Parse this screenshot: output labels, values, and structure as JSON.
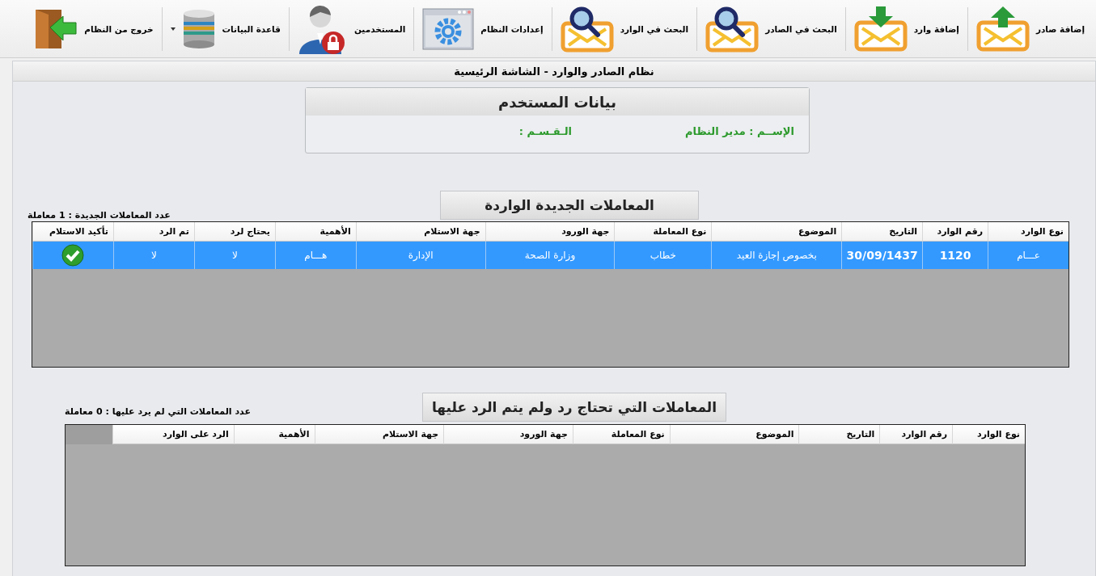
{
  "toolbar": [
    {
      "label": "إضافة صادر",
      "kind": "upload",
      "dropdown": false
    },
    {
      "label": "إضافة وارد",
      "kind": "download",
      "dropdown": false
    },
    {
      "label": "البحث في الصادر",
      "kind": "search",
      "dropdown": false
    },
    {
      "label": "البحث في الوارد",
      "kind": "search",
      "dropdown": false
    },
    {
      "label": "إعدادات النظام",
      "kind": "settings",
      "dropdown": false
    },
    {
      "label": "المستخدمين",
      "kind": "users",
      "dropdown": false
    },
    {
      "label": "قاعدة البيانات",
      "kind": "database",
      "dropdown": true
    },
    {
      "label": "خروج من النظام",
      "kind": "exit",
      "dropdown": false
    }
  ],
  "header": "نظام الصادر والوارد - الشاشة الرئيسية",
  "user_card": {
    "title": "بيانات المستخدم",
    "name": "الإســم : مدير النظام",
    "department": "الـقـسـم :"
  },
  "new_section": {
    "title": "المعاملات الجديدة الواردة",
    "count": "عدد المعاملات الجديدة : **1**  معاملة",
    "columns": [
      "نوع الوارد",
      "رقم الوارد",
      "التاريخ",
      "الموضوع",
      "نوع المعاملة",
      "جهة الورود",
      "جهة الاستلام",
      "الأهمية",
      "يحتاج لرد",
      "تم الرد",
      "تأكيد الاستلام"
    ],
    "rows": [
      {
        "selected": true,
        "confirmed": true,
        "cells": [
          "عـــام",
          "1120",
          "30/09/1437",
          "بخصوص إجازة العيد",
          "خطاب",
          "وزارة الصحة",
          "الإدارة",
          "هـــام",
          "لا",
          "لا"
        ]
      }
    ]
  },
  "pending_section": {
    "title": "المعاملات التي تحتاج رد ولم يتم الرد عليها",
    "count": "عدد المعاملات التي لم يرد عليها : **0**  معاملة",
    "columns": [
      "نوع الوارد",
      "رقم الوارد",
      "التاريخ",
      "الموضوع",
      "نوع المعاملة",
      "جهة الورود",
      "جهة الاستلام",
      "الأهمية",
      "الرد على الوارد"
    ]
  }
}
